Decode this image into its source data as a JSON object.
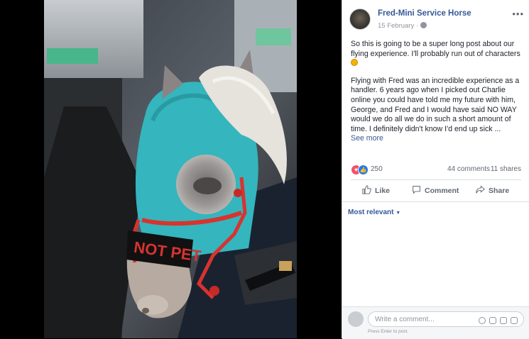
{
  "photo": {
    "description_icon": "photo-miniature-horse",
    "hood_text": "NOT PET"
  },
  "post": {
    "page_name": "Fred-Mini Service Horse",
    "date": "15 February",
    "more_icon": "ellipsis-icon",
    "more_label": "•••",
    "paragraph1": "So this is going to be a super long post about our flying experience. I'll probably run out of characters",
    "paragraph2": "Flying with Fred was an incredible experience as a handler. 6 years ago when I picked out Charlie online you could have told me my future with him, George, and Fred and I would have said NO WAY would we do all we do in such a short amount of time. I definitely didn't know I'd end up sick ...",
    "see_more": "See more"
  },
  "stats": {
    "reactions_count": "250",
    "comments": "44 comments",
    "shares": "11 shares"
  },
  "actions": {
    "like": "Like",
    "comment": "Comment",
    "share": "Share"
  },
  "comments": {
    "sort_label": "Most relevant",
    "placeholder": "Write a comment...",
    "hint": "Press Enter to post."
  },
  "colors": {
    "link": "#365899",
    "love": "#f25268",
    "like": "#2078f4"
  }
}
